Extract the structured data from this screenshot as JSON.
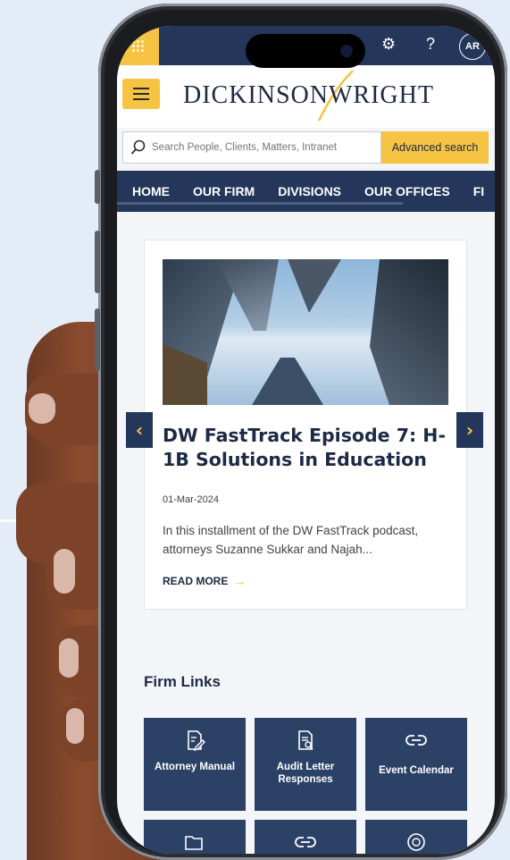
{
  "status_bar": {
    "avatar_initials": "AR",
    "icons": [
      "waffle-icon",
      "gear-icon",
      "help-icon"
    ]
  },
  "header": {
    "logo_text_1": "DICKINSON",
    "logo_text_2": "WRIGHT"
  },
  "search": {
    "placeholder": "Search People, Clients, Matters, Intranet",
    "advanced_label": "Advanced search"
  },
  "nav": {
    "items": [
      "HOME",
      "OUR FIRM",
      "DIVISIONS",
      "OUR OFFICES",
      "FI"
    ]
  },
  "carousel": {
    "title": "DW FastTrack Episode 7: H-1B Solutions in Education",
    "date": "01-Mar-2024",
    "description": "In this installment of the DW FastTrack podcast, attorneys Suzanne Sukkar and Najah...",
    "read_more": "READ MORE",
    "prev": "‹",
    "next": "›"
  },
  "firm_links": {
    "title": "Firm Links",
    "tiles": [
      {
        "label": "Attorney Manual",
        "icon": "document-edit-icon"
      },
      {
        "label": "Audit Letter Responses",
        "icon": "document-search-icon"
      },
      {
        "label": "Event Calendar",
        "icon": "link-icon"
      }
    ]
  },
  "colors": {
    "navy": "#24365a",
    "gold": "#f6c343"
  }
}
